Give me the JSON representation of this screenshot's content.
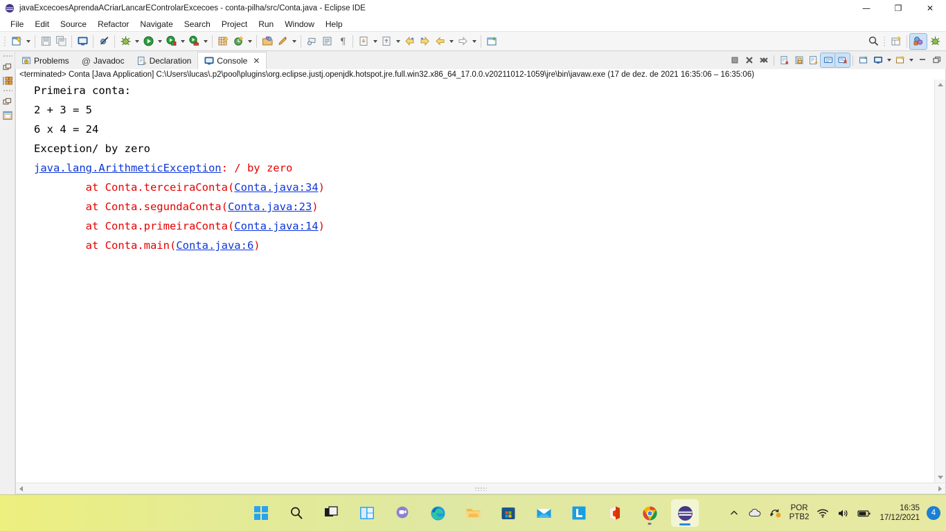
{
  "window": {
    "title": "javaExcecoesAprendaACriarLancarEControlarExcecoes - conta-pilha/src/Conta.java - Eclipse IDE",
    "logo_icon": "eclipse-logo",
    "minimize": "—",
    "maximize": "❐",
    "close": "✕"
  },
  "menubar": {
    "items": [
      {
        "label": "File"
      },
      {
        "label": "Edit"
      },
      {
        "label": "Source"
      },
      {
        "label": "Refactor"
      },
      {
        "label": "Navigate"
      },
      {
        "label": "Search"
      },
      {
        "label": "Project"
      },
      {
        "label": "Run"
      },
      {
        "label": "Window"
      },
      {
        "label": "Help"
      }
    ]
  },
  "toolbar": {
    "buttons": [
      {
        "name": "new-wizard-icon"
      },
      {
        "name": "save-icon"
      },
      {
        "name": "save-all-icon"
      },
      {
        "name": "new-java-console-icon"
      },
      {
        "name": "skip-breakpoints-icon"
      },
      {
        "name": "debug-icon"
      },
      {
        "name": "run-icon"
      },
      {
        "name": "coverage-icon"
      },
      {
        "name": "external-tools-icon"
      },
      {
        "name": "new-java-package-icon"
      },
      {
        "name": "new-class-icon"
      },
      {
        "name": "open-type-icon"
      },
      {
        "name": "search-declaration-icon"
      },
      {
        "name": "previous-annotation-icon"
      },
      {
        "name": "next-annotation-icon"
      },
      {
        "name": "last-edit-location-icon"
      },
      {
        "name": "back-icon"
      },
      {
        "name": "forward-icon"
      },
      {
        "name": "pin-editor-icon"
      }
    ],
    "right": {
      "search_icon": "search-icon",
      "new-perspective-icon": "open-perspective-icon",
      "java_perspective": "java-perspective-icon",
      "debug_perspective": "debug-perspective-icon"
    }
  },
  "fastview": {
    "items": [
      {
        "name": "restore-view-icon"
      },
      {
        "name": "package-explorer-icon"
      },
      {
        "name": "restore-view-2-icon"
      },
      {
        "name": "outline-view-icon"
      }
    ]
  },
  "view_tabs": [
    {
      "label": "Problems",
      "icon": "problems-icon",
      "active": false
    },
    {
      "label": "Javadoc",
      "icon": "javadoc-icon",
      "active": false
    },
    {
      "label": "Declaration",
      "icon": "declaration-icon",
      "active": false
    },
    {
      "label": "Console",
      "icon": "console-icon",
      "active": true,
      "close": "✕"
    }
  ],
  "view_toolbar": [
    {
      "name": "terminate-icon",
      "toggled": false
    },
    {
      "name": "remove-launch-icon",
      "toggled": false
    },
    {
      "name": "remove-all-terminated-icon",
      "toggled": false
    },
    {
      "name": "clear-console-icon",
      "toggled": false
    },
    {
      "name": "scroll-lock-icon",
      "toggled": false
    },
    {
      "name": "word-wrap-icon",
      "toggled": false
    },
    {
      "name": "show-console-on-output-icon",
      "toggled": true
    },
    {
      "name": "show-console-on-error-icon",
      "toggled": true
    },
    {
      "name": "pin-console-icon",
      "toggled": false
    },
    {
      "name": "display-selected-console-icon",
      "toggled": false
    },
    {
      "name": "open-console-icon",
      "toggled": false
    },
    {
      "name": "minimize-view-icon",
      "toggled": false
    },
    {
      "name": "maximize-view-icon",
      "toggled": false
    }
  ],
  "console": {
    "process_line": "<terminated> Conta [Java Application] C:\\Users\\lucas\\.p2\\pool\\plugins\\org.eclipse.justj.openjdk.hotspot.jre.full.win32.x86_64_17.0.0.v20211012-1059\\jre\\bin\\javaw.exe  (17 de dez. de 2021 16:35:06 – 16:35:06)",
    "lines": [
      {
        "type": "out",
        "text": "Primeira conta:"
      },
      {
        "type": "out",
        "text": "2 + 3 = 5"
      },
      {
        "type": "out",
        "text": "6 x 4 = 24"
      },
      {
        "type": "out",
        "text": "Exception/ by zero"
      },
      {
        "type": "err-head",
        "link": "java.lang.ArithmeticException",
        "rest": ": / by zero"
      },
      {
        "type": "err-frame",
        "prefix": "        at Conta.terceiraConta(",
        "link": "Conta.java:34",
        "suffix": ")"
      },
      {
        "type": "err-frame",
        "prefix": "        at Conta.segundaConta(",
        "link": "Conta.java:23",
        "suffix": ")"
      },
      {
        "type": "err-frame",
        "prefix": "        at Conta.primeiraConta(",
        "link": "Conta.java:14",
        "suffix": ")"
      },
      {
        "type": "err-frame",
        "prefix": "        at Conta.main(",
        "link": "Conta.java:6",
        "suffix": ")"
      }
    ]
  },
  "taskbar": {
    "items": [
      {
        "name": "start-button",
        "icon": "windows-logo"
      },
      {
        "name": "search-taskbar",
        "icon": "search-icon"
      },
      {
        "name": "task-view",
        "icon": "task-view-icon"
      },
      {
        "name": "widgets",
        "icon": "widgets-icon"
      },
      {
        "name": "teams-chat",
        "icon": "chat-icon"
      },
      {
        "name": "microsoft-edge",
        "icon": "edge-icon"
      },
      {
        "name": "file-explorer",
        "icon": "folder-icon"
      },
      {
        "name": "microsoft-store",
        "icon": "store-icon"
      },
      {
        "name": "mail",
        "icon": "mail-icon"
      },
      {
        "name": "l-app",
        "icon": "l-icon"
      },
      {
        "name": "office",
        "icon": "office-icon"
      },
      {
        "name": "google-chrome",
        "icon": "chrome-icon",
        "running": true
      },
      {
        "name": "eclipse-ide",
        "icon": "eclipse-logo",
        "active": true
      }
    ],
    "tray": {
      "chevron": "⌃",
      "cloud_icon": "cloud-icon",
      "sync_icon": "sync-icon",
      "lang_top": "POR",
      "lang_bottom": "PTB2",
      "wifi_icon": "wifi-icon",
      "volume_icon": "volume-icon",
      "battery_icon": "battery-icon",
      "time": "16:35",
      "date": "17/12/2021",
      "notification_count": "4"
    }
  },
  "colors": {
    "stdout": "#000000",
    "stderr": "#e60000",
    "link": "#0d35d9",
    "accent": "#cde2f7"
  }
}
